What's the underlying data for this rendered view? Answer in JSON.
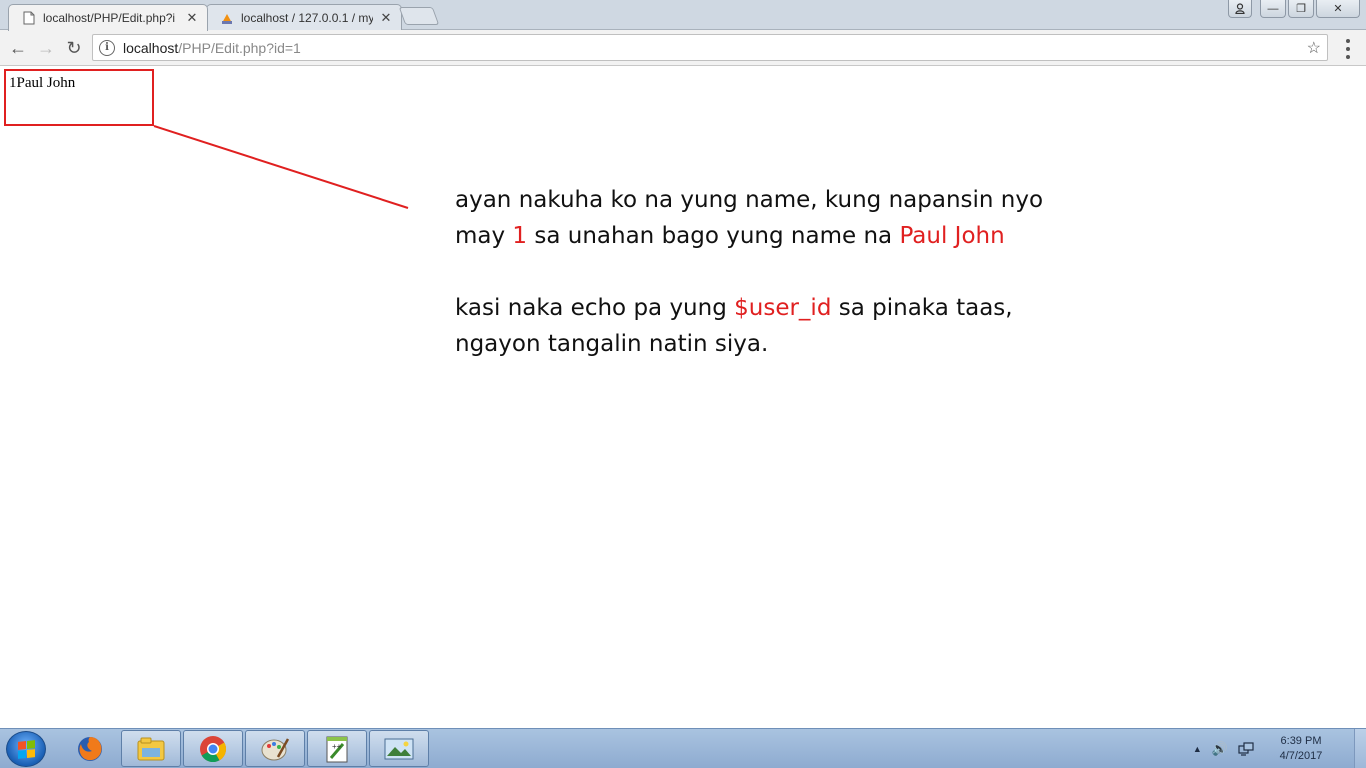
{
  "browser": {
    "tabs": [
      {
        "title": "localhost/PHP/Edit.php?i",
        "close": "✕",
        "active": true
      },
      {
        "title": "localhost / 127.0.0.1 / my",
        "close": "✕",
        "active": false
      }
    ],
    "window_controls": {
      "user": "user-icon",
      "minimize": "—",
      "restore": "❐",
      "close": "✕"
    },
    "nav": {
      "back": "←",
      "forward": "→",
      "reload": "↻"
    },
    "address": {
      "info": "i",
      "host": "localhost",
      "path": "/PHP/Edit.php?id=1"
    },
    "bookmark_star": "☆"
  },
  "page": {
    "output_text": "1Paul John",
    "annotation": {
      "line1": "ayan nakuha ko na yung name, kung napansin nyo",
      "line2_before": "may ",
      "line2_red1": "1",
      "line2_middle": " sa unahan bago yung name na ",
      "line2_red2": "Paul John",
      "line3_before": "kasi naka echo pa yung ",
      "line3_red": "$user_id",
      "line3_after": " sa pinaka taas,",
      "line4": "ngayon tangalin natin siya."
    },
    "colors": {
      "highlight": "#e02020"
    }
  },
  "taskbar": {
    "pinned": [
      "firefox-icon",
      "explorer-icon",
      "chrome-icon",
      "paint-icon",
      "notepad-plus-plus-icon",
      "photo-viewer-icon"
    ],
    "tray": {
      "arrow": "▲",
      "volume": "🔊",
      "network": "network-icon"
    },
    "clock": {
      "time": "6:39 PM",
      "date": "4/7/2017"
    }
  }
}
